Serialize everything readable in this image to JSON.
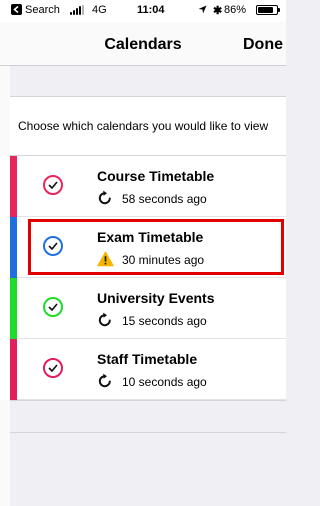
{
  "status_bar": {
    "carrier": "Search",
    "network": "4G",
    "time": "11:04",
    "battery": "86%",
    "battery_level": 0.86
  },
  "nav": {
    "title": "Calendars",
    "done_label": "Done"
  },
  "instructions": "Choose which calendars you would like to view",
  "calendars": [
    {
      "name": "Course Timetable",
      "status": "58 seconds ago",
      "status_icon": "refresh-icon",
      "color": "#e8265e",
      "checked": true
    },
    {
      "name": "Exam Timetable",
      "status": "30 minutes ago",
      "status_icon": "warning-icon",
      "color": "#1f6fe0",
      "checked": true,
      "highlighted": true
    },
    {
      "name": "University Events",
      "status": "15 seconds ago",
      "status_icon": "refresh-icon",
      "color": "#1edc2a",
      "checked": true
    },
    {
      "name": "Staff Timetable",
      "status": "10 seconds ago",
      "status_icon": "refresh-icon",
      "color": "#e01f5c",
      "checked": true
    }
  ],
  "colors": {
    "highlight": "#e10000",
    "warning": "#f5b400"
  }
}
